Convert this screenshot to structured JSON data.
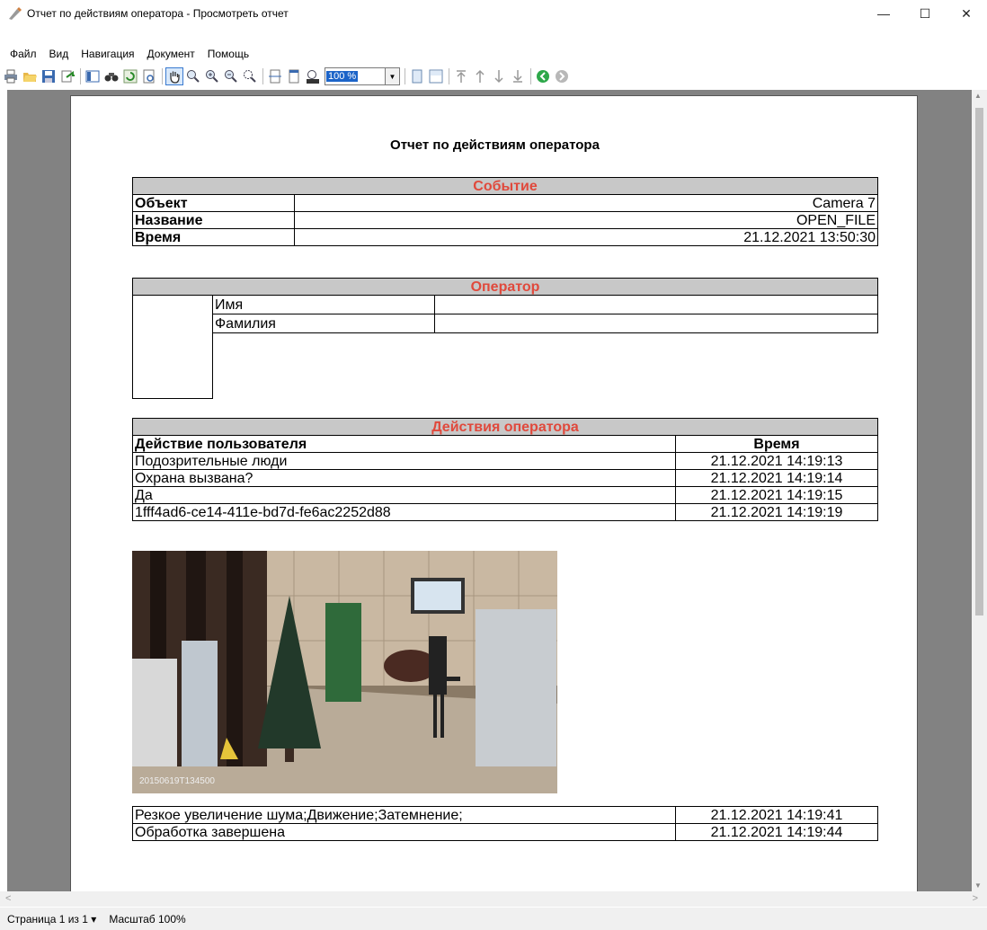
{
  "window": {
    "title": "Отчет по действиям оператора - Просмотреть отчет",
    "controls": {
      "minimize": "—",
      "maximize": "☐",
      "close": "✕"
    }
  },
  "menu": [
    "Файл",
    "Вид",
    "Навигация",
    "Документ",
    "Помощь"
  ],
  "toolbar": {
    "zoom_value": "100 %",
    "icons": [
      "print-icon",
      "open-icon",
      "save-icon",
      "export-icon",
      "toc-icon",
      "find-icon",
      "refresh-icon",
      "preview-icon",
      "hand-tool-icon",
      "zoom-icon",
      "zoom-in-icon",
      "zoom-out-icon",
      "zoom-rect-icon",
      "page-width-icon",
      "whole-page-icon",
      "actual-size-icon",
      "single-page-icon",
      "multi-page-icon",
      "first-page-icon",
      "prev-page-icon",
      "next-page-icon",
      "last-page-icon",
      "back-icon",
      "forward-icon"
    ]
  },
  "report": {
    "title": "Отчет по действиям оператора",
    "event": {
      "header": "Событие",
      "rows": [
        {
          "label": "Объект",
          "value": "Camera 7"
        },
        {
          "label": "Название",
          "value": "OPEN_FILE"
        },
        {
          "label": "Время",
          "value": "21.12.2021 13:50:30"
        }
      ]
    },
    "operator": {
      "header": "Оператор",
      "rows": [
        {
          "label": "Имя",
          "value": ""
        },
        {
          "label": "Фамилия",
          "value": ""
        }
      ]
    },
    "actions": {
      "header": "Действия оператора",
      "col_action": "Действие пользователя",
      "col_time": "Время",
      "rows": [
        {
          "action": "Подозрительные люди",
          "time": "21.12.2021 14:19:13"
        },
        {
          "action": "Охрана вызвана?",
          "time": "21.12.2021 14:19:14"
        },
        {
          "action": "Да",
          "time": "21.12.2021 14:19:15"
        },
        {
          "action": "1fff4ad6-ce14-411e-bd7d-fe6ac2252d88",
          "time": "21.12.2021 14:19:19"
        }
      ],
      "photo_timestamp": "20150619T134500",
      "rows_after": [
        {
          "action": "Резкое увеличение шума;Движение;Затемнение;",
          "time": "21.12.2021 14:19:41"
        },
        {
          "action": "Обработка завершена",
          "time": "21.12.2021 14:19:44"
        }
      ]
    }
  },
  "status": {
    "page": "Страница 1 из 1",
    "page_arrow": "▾",
    "zoom": "Масштаб 100%"
  },
  "colors": {
    "header_text": "#e0493c",
    "header_bg": "#c8c8c8",
    "viewer_bg": "#828282"
  }
}
